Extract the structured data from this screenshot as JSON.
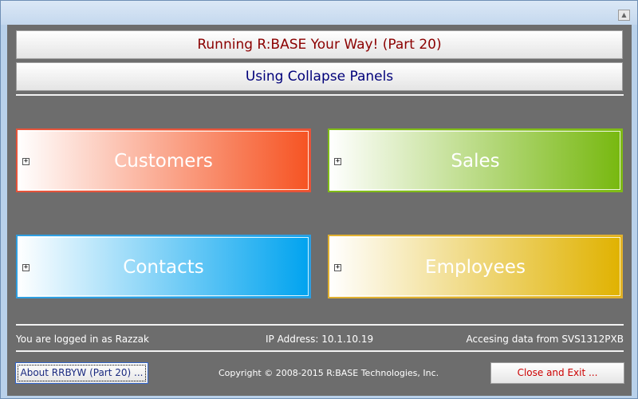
{
  "window": {
    "maximize_glyph": "▲"
  },
  "header": {
    "title": "Running R:BASE Your Way! (Part 20)",
    "subtitle": "Using Collapse Panels"
  },
  "panels": [
    {
      "label": "Customers",
      "expand_glyph": "+"
    },
    {
      "label": "Sales",
      "expand_glyph": "+"
    },
    {
      "label": "Contacts",
      "expand_glyph": "+"
    },
    {
      "label": "Employees",
      "expand_glyph": "+"
    }
  ],
  "status": {
    "login": "You are logged in as Razzak",
    "ip": "IP Address: 10.1.10.19",
    "data_source": "Accesing data from SVS1312PXB"
  },
  "footer": {
    "about_label": "About RRBYW (Part 20) ...",
    "copyright": "Copyright ©  2008-2015 R:BASE Technologies, Inc.",
    "exit_label": "Close and Exit ..."
  },
  "colors": {
    "customers": "#f65322",
    "sales": "#77b80f",
    "contacts": "#00a3ef",
    "employees": "#e0b200"
  },
  "icons": {
    "expand": "plus-box-icon",
    "maximize": "maximize-icon"
  }
}
